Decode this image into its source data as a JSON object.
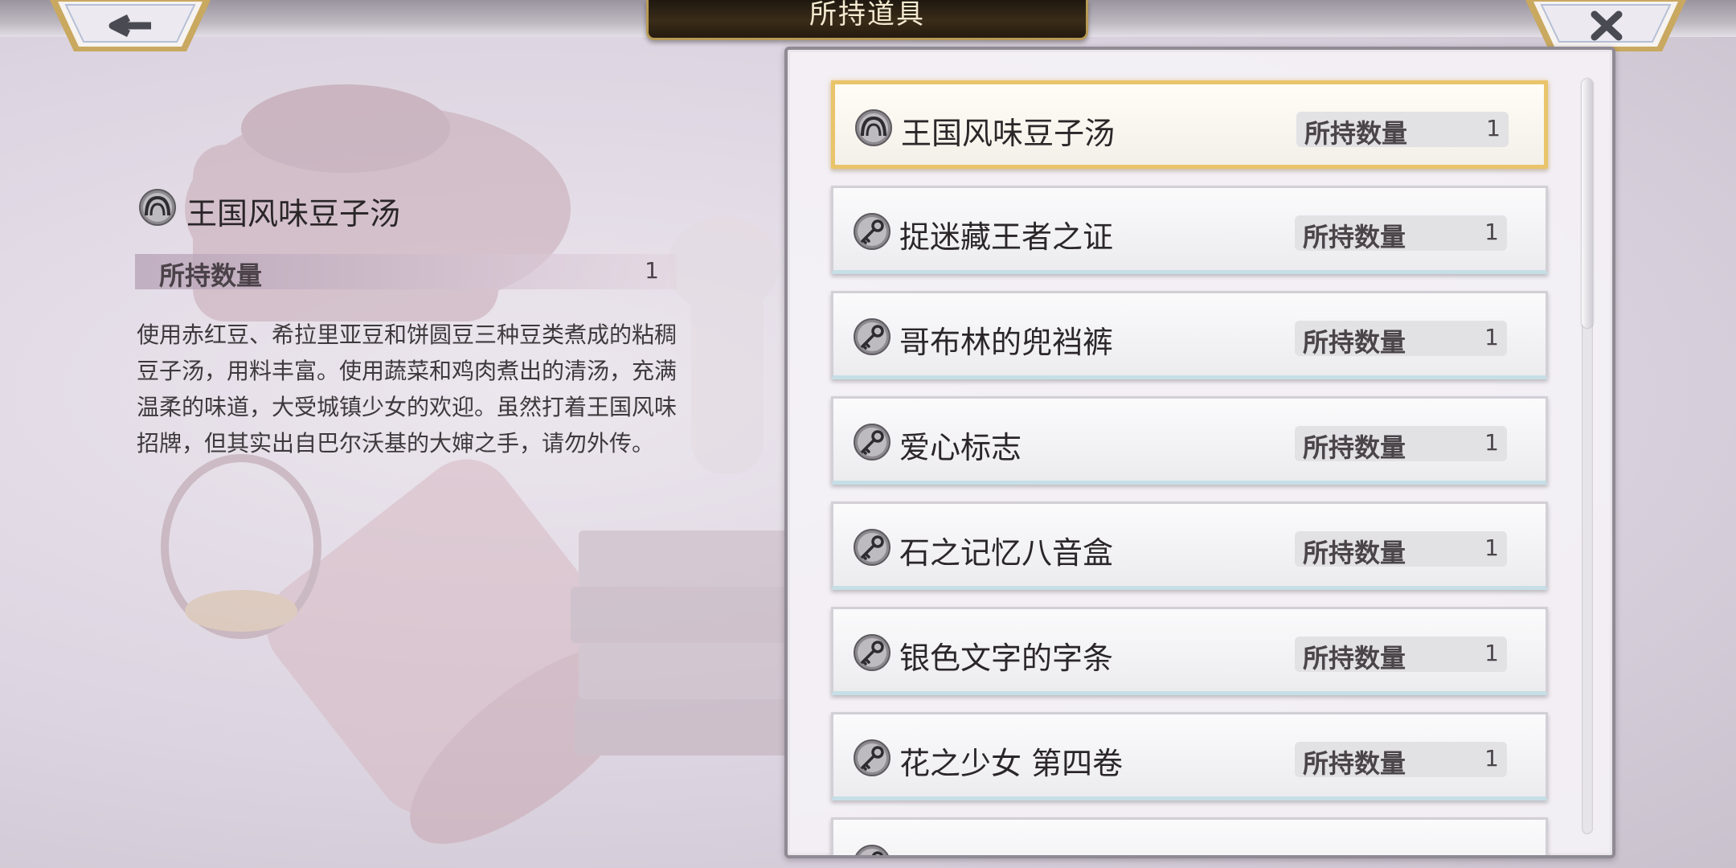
{
  "header": {
    "title": "所持道具",
    "back_icon": "left-arrow-icon",
    "close_icon": "x-close-icon"
  },
  "detail": {
    "icon": "bowl-dish-icon",
    "name": "王国风味豆子汤",
    "quantity_label": "所持数量",
    "quantity": "1",
    "description": "使用赤红豆、希拉里亚豆和饼圆豆三种豆类煮成的粘稠豆子汤，用料丰富。使用蔬菜和鸡肉煮出的清汤，充满温柔的味道，大受城镇少女的欢迎。虽然打着王国风味招牌，但其实出自巴尔沃基的大婶之手，请勿外传。"
  },
  "items": [
    {
      "name": "王国风味豆子汤",
      "icon": "bowl-dish-icon",
      "quantity_label": "所持数量",
      "quantity": "1",
      "selected": true
    },
    {
      "name": "捉迷藏王者之证",
      "icon": "key-icon",
      "quantity_label": "所持数量",
      "quantity": "1",
      "selected": false
    },
    {
      "name": "哥布林的兜裆裤",
      "icon": "key-icon",
      "quantity_label": "所持数量",
      "quantity": "1",
      "selected": false
    },
    {
      "name": "爱心标志",
      "icon": "key-icon",
      "quantity_label": "所持数量",
      "quantity": "1",
      "selected": false
    },
    {
      "name": "石之记忆八音盒",
      "icon": "key-icon",
      "quantity_label": "所持数量",
      "quantity": "1",
      "selected": false
    },
    {
      "name": "银色文字的字条",
      "icon": "key-icon",
      "quantity_label": "所持数量",
      "quantity": "1",
      "selected": false
    },
    {
      "name": "花之少女 第四卷",
      "icon": "key-icon",
      "quantity_label": "所持数量",
      "quantity": "1",
      "selected": false
    },
    {
      "name": "",
      "icon": "key-icon",
      "quantity_label": "",
      "quantity": "",
      "selected": false
    }
  ],
  "scrollbar": {
    "position": 0.0,
    "visible_fraction": 0.33
  },
  "colors": {
    "selected_border": "#e9c46a",
    "gold_trim": "#b89a55",
    "title_bg": "#2a2015"
  }
}
